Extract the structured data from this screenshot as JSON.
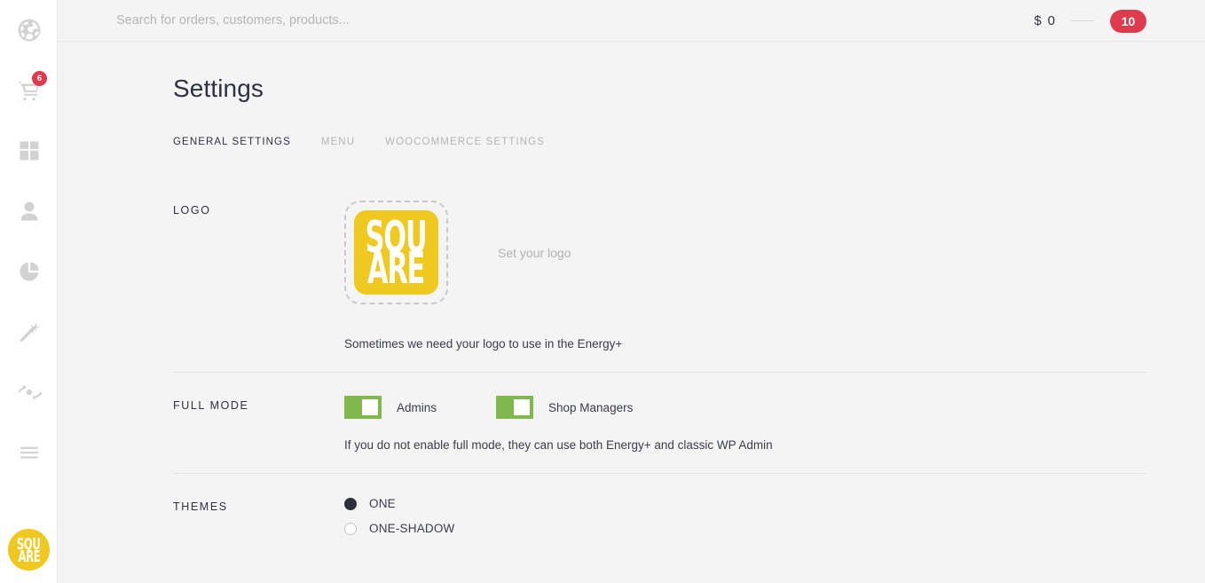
{
  "sidebar": {
    "items": [
      {
        "icon": "globe-icon",
        "name": "sidebar-item-globe",
        "badge": null
      },
      {
        "icon": "cart-icon",
        "name": "sidebar-item-orders",
        "badge": "6"
      },
      {
        "icon": "grid-icon",
        "name": "sidebar-item-dashboard",
        "badge": null
      },
      {
        "icon": "user-icon",
        "name": "sidebar-item-customers",
        "badge": null
      },
      {
        "icon": "pie-chart-icon",
        "name": "sidebar-item-reports",
        "badge": null
      },
      {
        "icon": "carrot-icon",
        "name": "sidebar-item-products",
        "badge": null
      },
      {
        "icon": "eye-refresh-icon",
        "name": "sidebar-item-preview",
        "badge": null
      },
      {
        "icon": "hamburger-icon",
        "name": "sidebar-item-menu",
        "badge": null
      }
    ],
    "logo": {
      "line1": "SQU",
      "line2": "ARE"
    }
  },
  "topbar": {
    "search_placeholder": "Search for orders, customers, products...",
    "search_value": "",
    "currency_symbol": "$",
    "amount": "0",
    "count": "10"
  },
  "page": {
    "title": "Settings",
    "tabs": [
      {
        "label": "General settings",
        "active": true
      },
      {
        "label": "Menu",
        "active": false
      },
      {
        "label": "WooCommerce settings",
        "active": false
      }
    ]
  },
  "sections": {
    "logo": {
      "label": "Logo",
      "logo_line1": "SQU",
      "logo_line2": "ARE",
      "set_logo_label": "Set your logo",
      "helper": "Sometimes we need your logo to use in the Energy+"
    },
    "full_mode": {
      "label": "Full mode",
      "toggles": [
        {
          "label": "Admins",
          "on": true
        },
        {
          "label": "Shop Managers",
          "on": true
        }
      ],
      "helper": "If you do not enable full mode, they can use both Energy+ and classic WP Admin"
    },
    "themes": {
      "label": "Themes",
      "options": [
        {
          "label": "ONE",
          "selected": true
        },
        {
          "label": "ONE-SHADOW",
          "selected": false
        }
      ]
    }
  },
  "colors": {
    "brand_yellow": "#efc91f",
    "accent_red": "#e03a4e",
    "toggle_green": "#7fb84c",
    "text_dark": "#2f3142",
    "text_muted": "#b4b4b6",
    "page_bg": "#f4f4f4"
  }
}
